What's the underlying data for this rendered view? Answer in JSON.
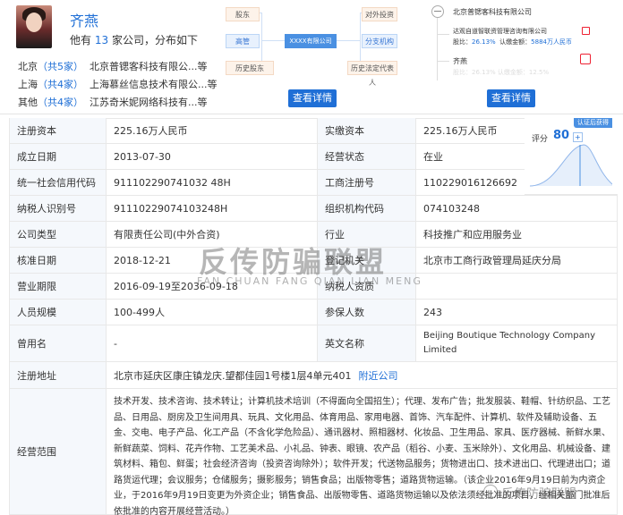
{
  "person": {
    "name": "齐燕",
    "summary_prefix": "他有",
    "company_count": "13",
    "summary_suffix": "家公司，分布如下",
    "cities": [
      {
        "city": "北京",
        "count_text": "（共5家）",
        "company": "北京普锶客科技有限公...等"
      },
      {
        "city": "上海",
        "count_text": "（共4家）",
        "company": "上海慕丝信息技术有限公...等"
      },
      {
        "city": "其他",
        "count_text": "（共4家）",
        "company": "江苏奇米妮网络科技有...等"
      }
    ]
  },
  "diagram": {
    "shareholder": "股东",
    "executive": "高管",
    "history_shareholder": "历史股东",
    "center": "XXXX有限公司",
    "outbound_investment": "对外投资",
    "branch": "分支机构",
    "history_outbound": "历史法定代表人",
    "button": "查看详情"
  },
  "right_panel": {
    "company": "北京普锶客科技有限公司",
    "child_company": "达观自道智联资管理咨询有限公司",
    "child_ratio_label": "股比：",
    "child_ratio": "26.13%",
    "child_capital_label": "认缴金额：",
    "child_capital": "5884万人民币",
    "person": "齐燕",
    "faded": "股比：26.13%  认缴金额：12.5%",
    "button": "查看详情"
  },
  "score": {
    "tag": "认证后获得",
    "label": "评分",
    "value": "80",
    "plus": "+"
  },
  "table": {
    "rows": [
      {
        "l1": "注册资本",
        "v1": "225.16万人民币",
        "l2": "实缴资本",
        "v2": "225.16万人民币"
      },
      {
        "l1": "成立日期",
        "v1": "2013-07-30",
        "l2": "经营状态",
        "v2": "在业"
      },
      {
        "l1": "统一社会信用代码",
        "v1": "911102290741032 48H",
        "l2": "工商注册号",
        "v2": "110229016126692"
      },
      {
        "l1": "纳税人识别号",
        "v1": "91110229074103248H",
        "l2": "组织机构代码",
        "v2": "074103248"
      },
      {
        "l1": "公司类型",
        "v1": "有限责任公司(中外合资)",
        "l2": "行业",
        "v2": "科技推广和应用服务业"
      },
      {
        "l1": "核准日期",
        "v1": "2018-12-21",
        "l2": "登记机关",
        "v2": "北京市工商行政管理局延庆分局"
      },
      {
        "l1": "营业期限",
        "v1": "2016-09-19至2036-09-18",
        "l2": "纳税人资质",
        "v2": ""
      },
      {
        "l1": "人员规模",
        "v1": "100-499人",
        "l2": "参保人数",
        "v2": "243"
      },
      {
        "l1": "曾用名",
        "v1": "-",
        "l2": "英文名称",
        "v2": "Beijing Boutique Technology Company Limited"
      }
    ],
    "address_label": "注册地址",
    "address": "北京市延庆区康庄镇龙庆.望都佳园1号楼1层4单元401",
    "address_link": "附近公司",
    "scope_label": "经营范围",
    "scope": "技术开发、技术咨询、技术转让；计算机技术培训（不得面向全国招生）；代理、发布广告；批发服装、鞋帽、针纺织品、工艺品、日用品、厨房及卫生间用具、玩具、文化用品、体育用品、家用电器、首饰、汽车配件、计算机、软件及辅助设备、五金、交电、电子产品、化工产品（不含化学危险品）、通讯器材、照相器材、化妆品、卫生用品、家具、医疗器械、新鲜水果、新鲜蔬菜、饲料、花卉作物、工艺美术品、小礼品、钟表、眼镜、农产品（稻谷、小麦、玉米除外）、文化用品、机械设备、建筑材料、箱包、鲜蛋；社会经济咨询（投资咨询除外）；软件开发；代送物品服务；货物进出口、技术进出口、代理进出口；道路货运代理；会议服务；仓储服务；摄影服务；销售食品；出版物零售；道路货物运输。（该企业2016年9月19日前为内资企业，于2016年9月19日变更为外资企业；销售食品、出版物零售、道路货物运输以及依法须经批准的项目，经相关部门批准后依批准的内容开展经营活动。）"
  },
  "watermark": {
    "main": "反传防骗联盟",
    "sub": "FAN CHUAN FANG QIAN LIAN MENG",
    "corner": "反传防骗联盟"
  }
}
